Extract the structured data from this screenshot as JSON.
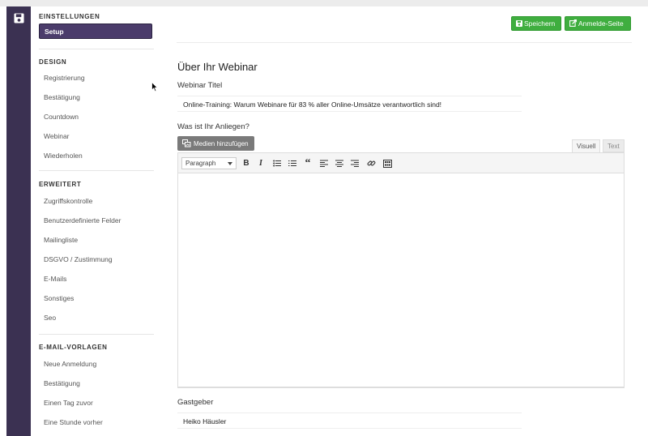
{
  "sidebar": {
    "settings_heading": "EINSTELLUNGEN",
    "setup_label": "Setup",
    "sections": [
      {
        "heading": "DESIGN",
        "items": [
          "Registrierung",
          "Bestätigung",
          "Countdown",
          "Webinar",
          "Wiederholen"
        ]
      },
      {
        "heading": "ERWEITERT",
        "items": [
          "Zugriffskontrolle",
          "Benutzerdefinierte Felder",
          "Mailingliste",
          "DSGVO / Zustimmung",
          "E-Mails",
          "Sonstiges",
          "Seo"
        ]
      },
      {
        "heading": "E-MAIL-VORLAGEN",
        "items": [
          "Neue Anmeldung",
          "Bestätigung",
          "Einen Tag zuvor",
          "Eine Stunde vorher"
        ]
      }
    ]
  },
  "toolbar_top": {
    "save_label": "Speichern",
    "login_page_label": "Anmelde-Seite"
  },
  "main": {
    "title": "Über Ihr Webinar",
    "webinar_title_label": "Webinar Titel",
    "webinar_title_value": "Online-Training: Warum Webinare für 83 % aller Online-Umsätze verantwortlich sind!",
    "concern_label": "Was ist Ihr Anliegen?",
    "media_button_label": "Medien hinzufügen",
    "tab_visual": "Visuell",
    "tab_text": "Text",
    "format_select_value": "Paragraph",
    "host_label": "Gastgeber",
    "host_value": "Heiko Häusler"
  },
  "colors": {
    "rail": "#3b3152",
    "setup_active": "#4b3c6b",
    "green_button": "#3fae3f"
  },
  "icons": [
    "save-icon",
    "floppy-icon",
    "external-edit-icon",
    "media-icon",
    "bold-icon",
    "italic-icon",
    "bullet-list-icon",
    "numbered-list-icon",
    "blockquote-icon",
    "align-left-icon",
    "align-center-icon",
    "align-right-icon",
    "link-icon",
    "toolbar-toggle-icon"
  ]
}
